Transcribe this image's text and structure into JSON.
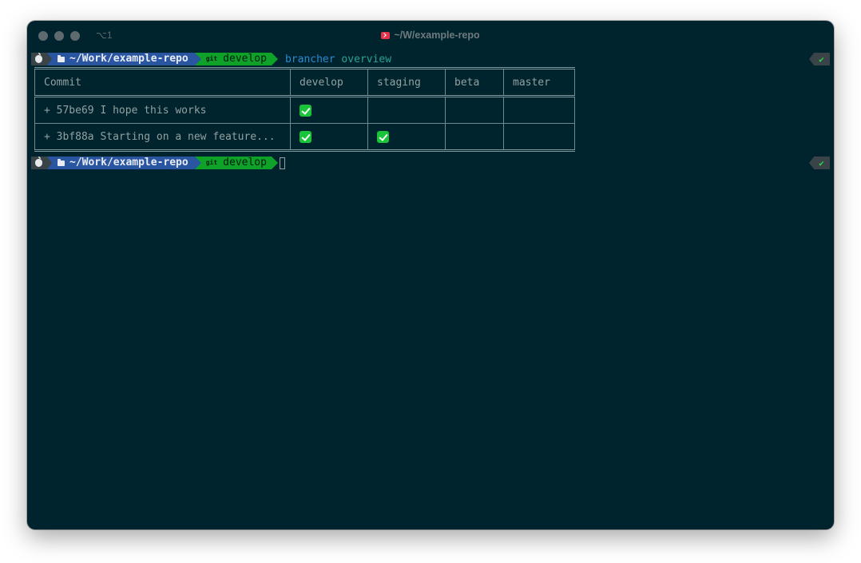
{
  "window": {
    "tab_shortcut": "⌥1",
    "title": "~/W/example-repo"
  },
  "prompt": {
    "directory": "~/Work/example-repo",
    "git_label": "git",
    "branch": "develop",
    "status_glyph": "✔"
  },
  "command": {
    "name": "brancher",
    "arg": "overview"
  },
  "table": {
    "headers": [
      "Commit",
      "develop",
      "staging",
      "beta",
      "master"
    ],
    "rows": [
      {
        "commit": "+ 57be69 I hope this works",
        "checks": [
          true,
          false,
          false,
          false
        ]
      },
      {
        "commit": "+ 3bf88a Starting on a new feature...",
        "checks": [
          true,
          true,
          false,
          false
        ]
      }
    ]
  },
  "icons": {
    "apple": "apple-icon",
    "folder": "folder-icon",
    "git": "git-icon",
    "check": "check-mark-icon",
    "terminal": "terminal-icon"
  },
  "colors": {
    "background": "#00242e",
    "dir_segment": "#2a55a0",
    "git_segment": "#0fa228",
    "command": "#268bd2",
    "argument": "#2aa198",
    "check": "#19c43a"
  }
}
